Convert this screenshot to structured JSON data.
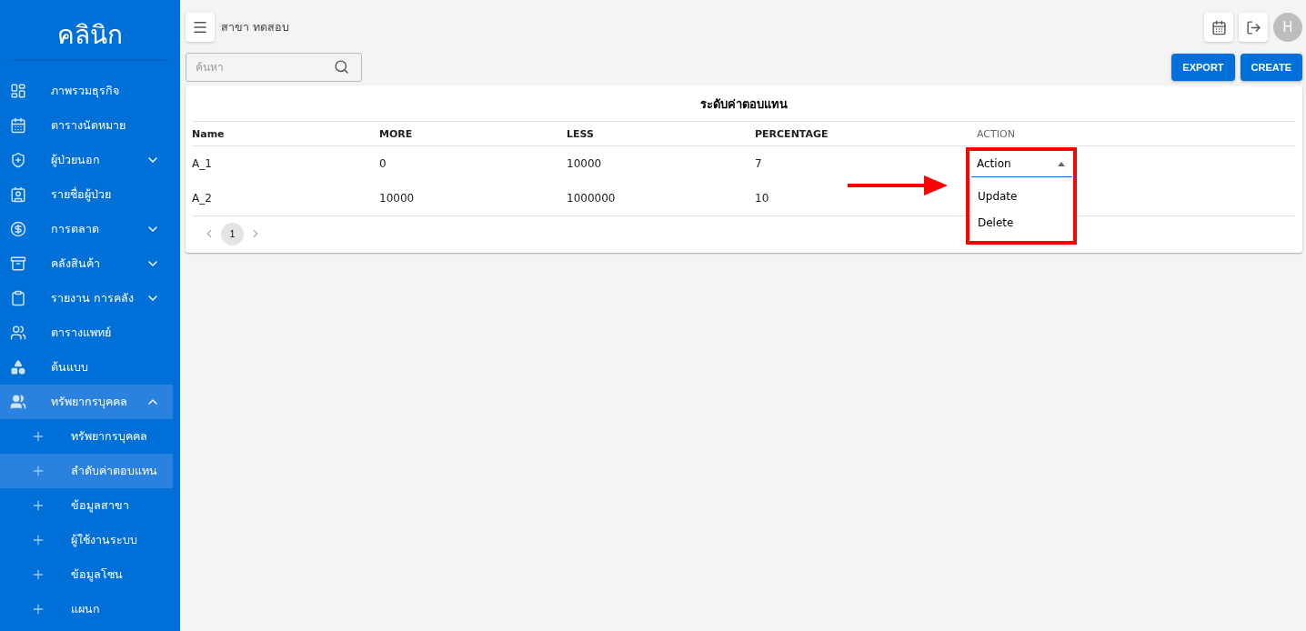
{
  "sidebar": {
    "title": "คลินิก",
    "items": [
      {
        "label": "ภาพรวมธุรกิจ",
        "kind": "item"
      },
      {
        "label": "ตารางนัดหมาย",
        "kind": "item"
      },
      {
        "label": "ผู้ป่วยนอก",
        "kind": "group",
        "expanded": false
      },
      {
        "label": "รายชื่อผู้ป่วย",
        "kind": "item"
      },
      {
        "label": "การตลาด",
        "kind": "group",
        "expanded": false
      },
      {
        "label": "คลังสินค้า",
        "kind": "group",
        "expanded": false
      },
      {
        "label": "รายงาน การคลัง",
        "kind": "group",
        "expanded": false
      },
      {
        "label": "ตารางแพทย์",
        "kind": "item"
      },
      {
        "label": "ต้นแบบ",
        "kind": "item"
      },
      {
        "label": "ทรัพยากรบุคคล",
        "kind": "group",
        "expanded": true,
        "children": [
          {
            "label": "ทรัพยากรบุคคล",
            "selected": false
          },
          {
            "label": "ลำดับค่าตอบแทน",
            "selected": true
          },
          {
            "label": "ข้อมูลสาขา",
            "selected": false
          },
          {
            "label": "ผู้ใช้งานระบบ",
            "selected": false
          },
          {
            "label": "ข้อมูลโซน",
            "selected": false
          },
          {
            "label": "แผนก",
            "selected": false
          }
        ]
      }
    ]
  },
  "topbar": {
    "branch": "สาขา ทดสอบ",
    "avatar": "H"
  },
  "search": {
    "placeholder": "ค้นหา"
  },
  "buttons": [
    "EXPORT",
    "CREATE"
  ],
  "table": {
    "title": "ระดับค่าตอบแทน",
    "columns": [
      "Name",
      "MORE",
      "LESS",
      "PERCENTAGE",
      "ACTION"
    ],
    "rows": [
      {
        "cells": [
          "A_1",
          "0",
          "10000",
          "7"
        ],
        "action": {
          "value": "Action",
          "expanded": true,
          "options": [
            "Update",
            "Delete"
          ]
        }
      },
      {
        "cells": [
          "A_2",
          "10000",
          "1000000",
          "10"
        ]
      }
    ],
    "pages": [
      {
        "label": "1",
        "selected": true
      }
    ]
  }
}
